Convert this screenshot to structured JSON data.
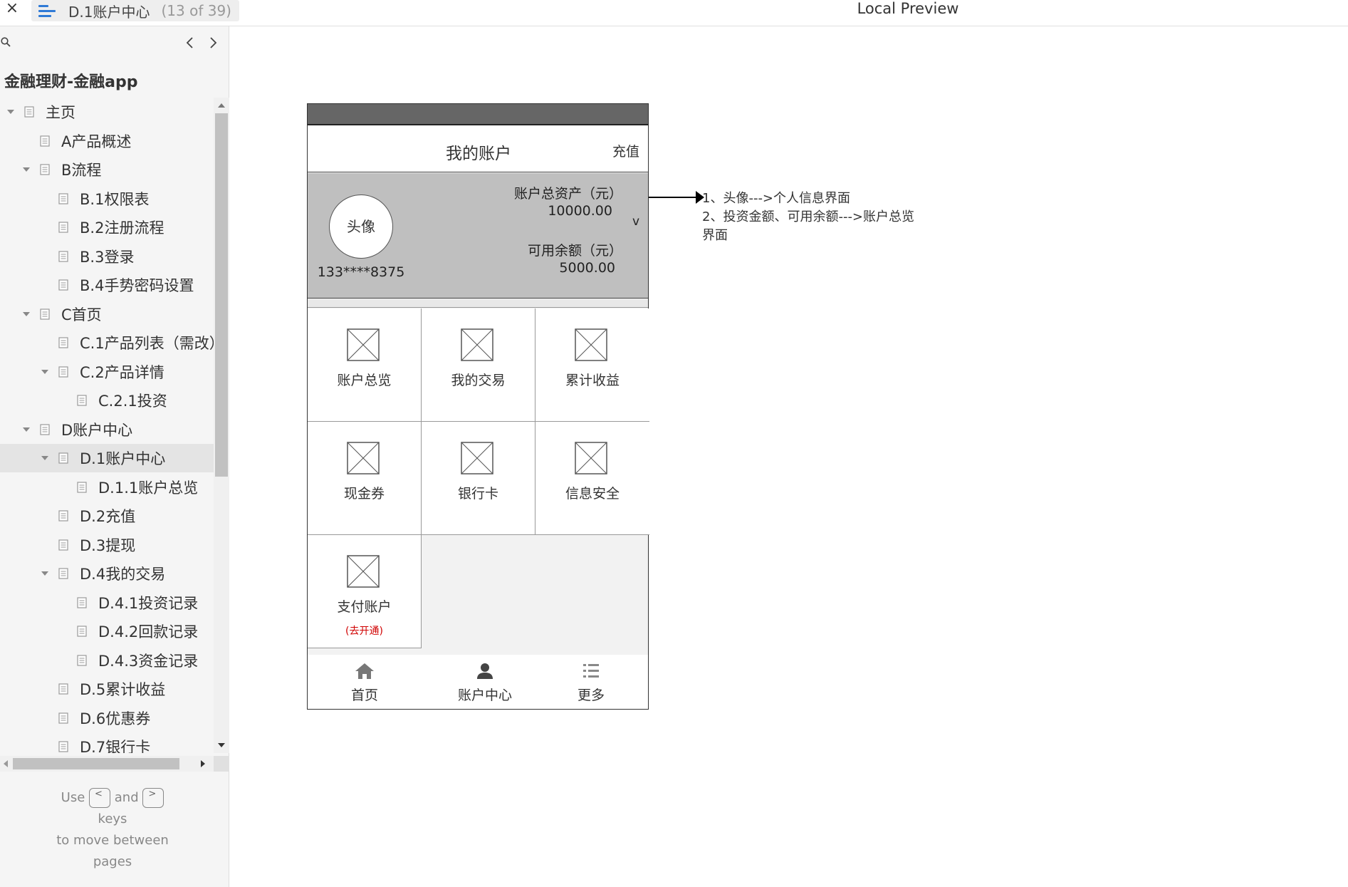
{
  "topbar": {
    "close_glyph": "×",
    "page_name": "D.1账户中心",
    "page_count": "(13 of 39)",
    "preview_title": "Local Preview"
  },
  "sidebar": {
    "project_title": "金融理财-金融app",
    "items": [
      {
        "label": "主页",
        "level": 0,
        "expanded": true
      },
      {
        "label": "A产品概述",
        "level": 1
      },
      {
        "label": "B流程",
        "level": 1,
        "expanded": true
      },
      {
        "label": "B.1权限表",
        "level": 2
      },
      {
        "label": "B.2注册流程",
        "level": 2
      },
      {
        "label": "B.3登录",
        "level": 2
      },
      {
        "label": "B.4手势密码设置",
        "level": 2
      },
      {
        "label": "C首页",
        "level": 1,
        "expanded": true
      },
      {
        "label": "C.1产品列表（需改）",
        "level": 2
      },
      {
        "label": "C.2产品详情",
        "level": 2,
        "expanded": true
      },
      {
        "label": "C.2.1投资",
        "level": 3
      },
      {
        "label": "D账户中心",
        "level": 1,
        "expanded": true
      },
      {
        "label": "D.1账户中心",
        "level": 2,
        "expanded": true,
        "selected": true
      },
      {
        "label": "D.1.1账户总览",
        "level": 3
      },
      {
        "label": "D.2充值",
        "level": 2
      },
      {
        "label": "D.3提现",
        "level": 2
      },
      {
        "label": "D.4我的交易",
        "level": 2,
        "expanded": true
      },
      {
        "label": "D.4.1投资记录",
        "level": 3
      },
      {
        "label": "D.4.2回款记录",
        "level": 3
      },
      {
        "label": "D.4.3资金记录",
        "level": 3
      },
      {
        "label": "D.5累计收益",
        "level": 2
      },
      {
        "label": "D.6优惠券",
        "level": 2
      },
      {
        "label": "D.7银行卡",
        "level": 2
      }
    ],
    "help": {
      "use": "Use",
      "prev_key": "<",
      "and": "and",
      "next_key": ">",
      "keys": "keys",
      "line3": "to move between",
      "line4": "pages"
    }
  },
  "phone": {
    "nav_title": "我的账户",
    "nav_action": "充值",
    "avatar_label": "头像",
    "phone_number": "133****8375",
    "total_assets_label": "账户总资产（元）",
    "total_assets_value": "10000.00",
    "balance_label": "可用余额（元）",
    "balance_value": "5000.00",
    "expand_glyph": "v",
    "grid": [
      {
        "label": "账户总览"
      },
      {
        "label": "我的交易"
      },
      {
        "label": "累计收益"
      },
      {
        "label": "现金券"
      },
      {
        "label": "银行卡"
      },
      {
        "label": "信息安全"
      },
      {
        "label": "支付账户",
        "sub": "(去开通)"
      }
    ],
    "tabs": [
      {
        "label": "首页",
        "icon": "home-icon"
      },
      {
        "label": "账户中心",
        "icon": "user-icon"
      },
      {
        "label": "更多",
        "icon": "list-icon"
      }
    ]
  },
  "annotation": {
    "line1": "1、头像--->个人信息界面",
    "line2": "2、投资金额、可用余额--->账户总览",
    "line3": "界面"
  },
  "colors": {
    "accent": "#2f7ad6",
    "status_bar": "#666666",
    "account_panel": "#bfbfbf",
    "highlight_red": "#d00000"
  }
}
